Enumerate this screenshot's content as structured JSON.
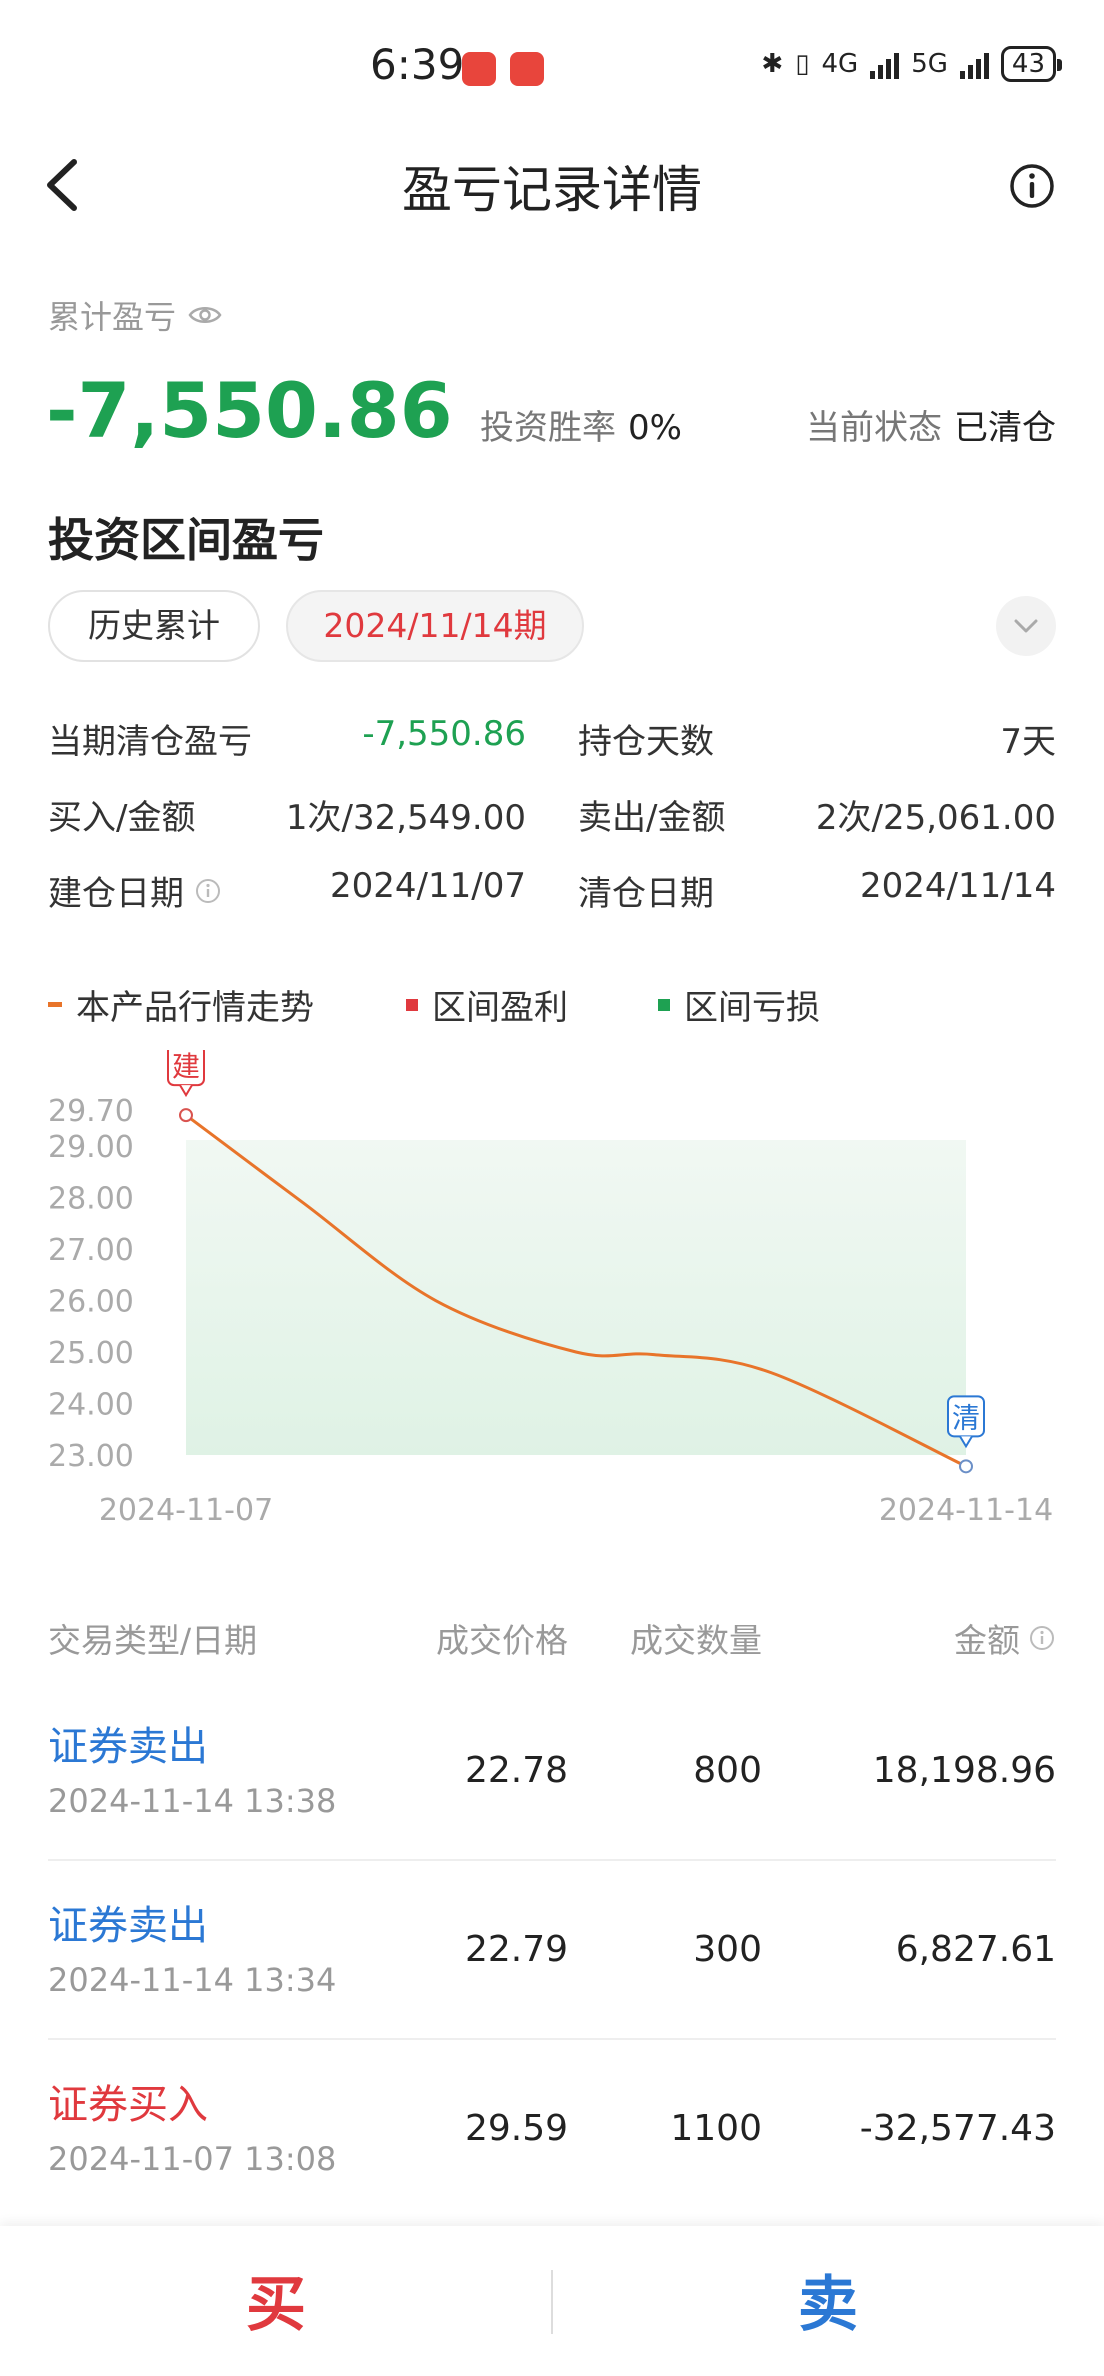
{
  "status_bar": {
    "time": "6:39",
    "network_1": "4G",
    "network_2": "5G",
    "battery": "43"
  },
  "header": {
    "title": "盈亏记录详情",
    "back_icon": "chevron-left-icon",
    "info_icon": "info-circle-icon"
  },
  "summary": {
    "cumulative_label": "累计盈亏",
    "cumulative_value": "-7,550.86",
    "win_rate_label": "投资胜率",
    "win_rate_value": "0%",
    "status_label": "当前状态",
    "status_value": "已清仓"
  },
  "section": {
    "title": "投资区间盈亏",
    "tabs": [
      "历史累计",
      "2024/11/14期"
    ]
  },
  "stats": {
    "period_pnl_label": "当期清仓盈亏",
    "period_pnl_value": "-7,550.86",
    "holding_days_label": "持仓天数",
    "holding_days_value": "7天",
    "buy_label": "买入/金额",
    "buy_value": "1次/32,549.00",
    "sell_label": "卖出/金额",
    "sell_value": "2次/25,061.00",
    "open_date_label": "建仓日期",
    "open_date_value": "2024/11/07",
    "close_date_label": "清仓日期",
    "close_date_value": "2024/11/14"
  },
  "legend": {
    "trend": "本产品行情走势",
    "profit": "区间盈利",
    "loss": "区间亏损"
  },
  "colors": {
    "loss_green": "#1ea152",
    "profit_red": "#e0393e",
    "line_orange": "#e8742a",
    "sell_blue": "#2b78d4"
  },
  "chart_data": {
    "type": "area",
    "x": [
      "2024-11-07",
      "2024-11-14"
    ],
    "x_tick_labels": [
      "2024-11-07",
      "2024-11-14"
    ],
    "y_tick_labels": [
      "29.70",
      "29.00",
      "28.00",
      "27.00",
      "26.00",
      "25.00",
      "24.00",
      "23.00"
    ],
    "ylim": [
      23.0,
      29.7
    ],
    "series": [
      {
        "name": "本产品行情走势",
        "points": [
          {
            "x": 0.0,
            "y": 29.6
          },
          {
            "x": 0.15,
            "y": 27.9
          },
          {
            "x": 0.32,
            "y": 26.0
          },
          {
            "x": 0.5,
            "y": 25.0
          },
          {
            "x": 0.6,
            "y": 24.95
          },
          {
            "x": 0.75,
            "y": 24.6
          },
          {
            "x": 1.0,
            "y": 22.78
          }
        ]
      }
    ],
    "markers": [
      {
        "label": "建",
        "x": "2024-11-07",
        "y": 29.6
      },
      {
        "label": "清",
        "x": "2024-11-14",
        "y": 22.78
      }
    ]
  },
  "table": {
    "headers": [
      "交易类型/日期",
      "成交价格",
      "成交数量",
      "金额"
    ],
    "rows": [
      {
        "type": "证券卖出",
        "kind": "sell",
        "datetime": "2024-11-14 13:38",
        "price": "22.78",
        "qty": "800",
        "amount": "18,198.96"
      },
      {
        "type": "证券卖出",
        "kind": "sell",
        "datetime": "2024-11-14 13:34",
        "price": "22.79",
        "qty": "300",
        "amount": "6,827.61"
      },
      {
        "type": "证券买入",
        "kind": "buy",
        "datetime": "2024-11-07 13:08",
        "price": "29.59",
        "qty": "1100",
        "amount": "-32,577.43"
      }
    ]
  },
  "bottom_bar": {
    "buy": "买",
    "sell": "卖"
  }
}
